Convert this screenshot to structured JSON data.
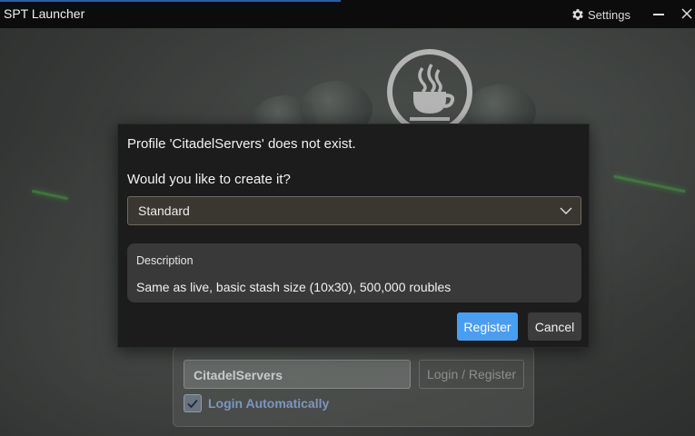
{
  "window": {
    "title": "SPT Launcher",
    "settings_label": "Settings",
    "icons": {
      "settings": "gear-icon",
      "minimize": "minimize-icon",
      "close": "close-icon"
    }
  },
  "background": {
    "logo": "spt-logo",
    "login": {
      "username": "CitadelServers",
      "login_button": "Login / Register",
      "auto_login_label": "Login Automatically",
      "auto_login_checked": true
    }
  },
  "dialog": {
    "message": "Profile 'CitadelServers' does not exist.",
    "question": "Would you like to create it?",
    "edition_selected": "Standard",
    "description_title": "Description",
    "description_text": "Same as live, basic stash size (10x30), 500,000 roubles",
    "register_label": "Register",
    "cancel_label": "Cancel"
  },
  "colors": {
    "accent": "#4a9ef2",
    "dialog_bg": "#1c1c1c",
    "select_bg": "#3a3630",
    "link": "#7d96bf"
  }
}
